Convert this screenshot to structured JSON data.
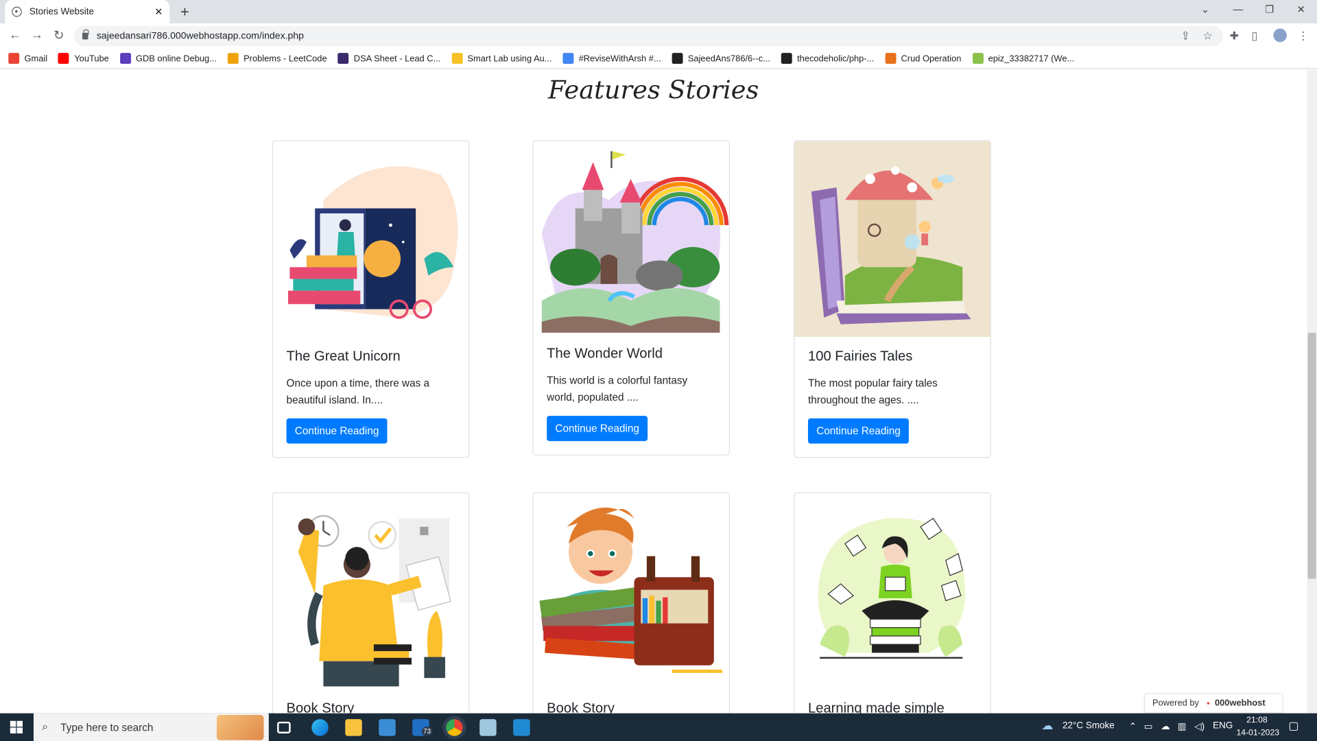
{
  "browser": {
    "tab_title": "Stories Website",
    "url": "sajeedansari786.000webhostapp.com/index.php",
    "bookmarks": [
      {
        "label": "Gmail",
        "color": "#ea4335"
      },
      {
        "label": "YouTube",
        "color": "#ff0000"
      },
      {
        "label": "GDB online Debug...",
        "color": "#5b3dbd"
      },
      {
        "label": "Problems - LeetCode",
        "color": "#f0a30a"
      },
      {
        "label": "DSA Sheet - Lead C...",
        "color": "#3b2a6b"
      },
      {
        "label": "Smart Lab using Au...",
        "color": "#f6c026"
      },
      {
        "label": "#ReviseWithArsh #...",
        "color": "#4285f4"
      },
      {
        "label": "SajeedAns786/6--c...",
        "color": "#222222"
      },
      {
        "label": "thecodeholic/php-...",
        "color": "#222222"
      },
      {
        "label": "Crud Operation",
        "color": "#e8711a"
      },
      {
        "label": "epiz_33382717 (We...",
        "color": "#8bc34a"
      }
    ]
  },
  "page": {
    "heading": "Features Stories",
    "cards": [
      {
        "title": "The Great Unicorn",
        "text": "Once upon a time, there was a beautiful island. In....",
        "button": "Continue Reading",
        "image": "girl-reading-book-illustration"
      },
      {
        "title": "The Wonder World",
        "text": "This world is a colorful fantasy world, populated ....",
        "button": "Continue Reading",
        "image": "castle-rainbow-book-illustration"
      },
      {
        "title": "100 Fairies Tales",
        "text": "The most popular fairy tales throughout the ages. ....",
        "button": "Continue Reading",
        "image": "fairy-mushroom-house-illustration"
      },
      {
        "title": "Book Story",
        "image": "student-with-books-illustration"
      },
      {
        "title": "Book Story",
        "image": "boy-with-books-illustration"
      },
      {
        "title": "Learning made simple",
        "image": "woman-reading-on-books-illustration"
      }
    ],
    "powered_label": "Powered by",
    "powered_brand": "000webhost"
  },
  "taskbar": {
    "search_placeholder": "Type here to search",
    "weather": "22°C  Smoke",
    "language": "ENG",
    "time": "21:08",
    "date": "14-01-2023",
    "mail_badge": "73"
  },
  "colors": {
    "primary_button": "#007bff",
    "taskbar": "#1c2b3a"
  }
}
